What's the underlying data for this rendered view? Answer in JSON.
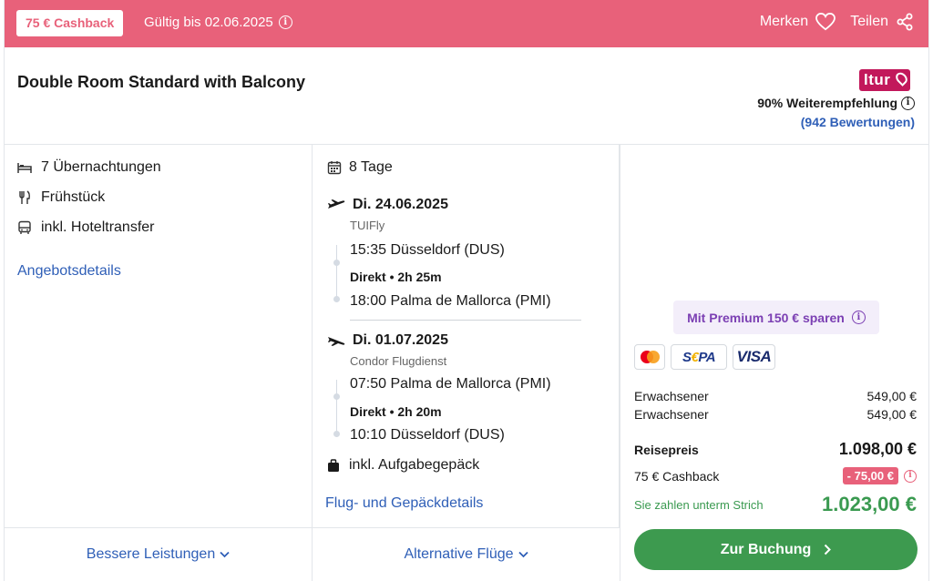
{
  "banner": {
    "cashback_badge": "75 € Cashback",
    "valid_until": "Gültig bis 02.06.2025",
    "save_label": "Merken",
    "share_label": "Teilen",
    "color": "#e8617a"
  },
  "offer": {
    "room_title": "Double Room Standard with Balcony",
    "brand_logo_text": "ltur",
    "recommendation": "90% Weiterempfehlung",
    "reviews": "(942 Bewertungen)"
  },
  "features": {
    "nights": "7 Übernachtungen",
    "board": "Frühstück",
    "transfer": "inkl. Hoteltransfer",
    "details_link": "Angebotsdetails",
    "better_services": "Bessere Leistungen"
  },
  "flights": {
    "duration": "8 Tage",
    "outbound": {
      "date": "Di. 24.06.2025",
      "airline": "TUIFly",
      "dep_time": "15:35",
      "dep_airport": "Düsseldorf (DUS)",
      "direct": "Direkt • 2h 25m",
      "arr_time": "18:00",
      "arr_airport": "Palma de Mallorca (PMI)"
    },
    "return": {
      "date": "Di. 01.07.2025",
      "airline": "Condor Flugdienst",
      "dep_time": "07:50",
      "dep_airport": "Palma de Mallorca (PMI)",
      "direct": "Direkt • 2h 20m",
      "arr_time": "10:10",
      "arr_airport": "Düsseldorf (DUS)"
    },
    "baggage": "inkl. Aufgabegepäck",
    "details_link": "Flug- und Gepäckdetails",
    "alternative": "Alternative Flüge"
  },
  "pricing": {
    "premium": "Mit Premium 150 € sparen",
    "payment_methods": [
      "mastercard-icon",
      "sepa-icon",
      "visa-icon"
    ],
    "sepa_text": "S€PA",
    "visa_text": "VISA",
    "travelers": [
      {
        "label": "Erwachsener",
        "price": "549,00 €"
      },
      {
        "label": "Erwachsener",
        "price": "549,00 €"
      }
    ],
    "total_label": "Reisepreis",
    "total": "1.098,00 €",
    "cashback_label": "75 € Cashback",
    "cashback_value": "- 75,00 €",
    "final_label": "Sie zahlen unterm Strich",
    "final": "1.023,00 €",
    "book_button": "Zur Buchung",
    "accent_green": "#3d9a4f"
  }
}
